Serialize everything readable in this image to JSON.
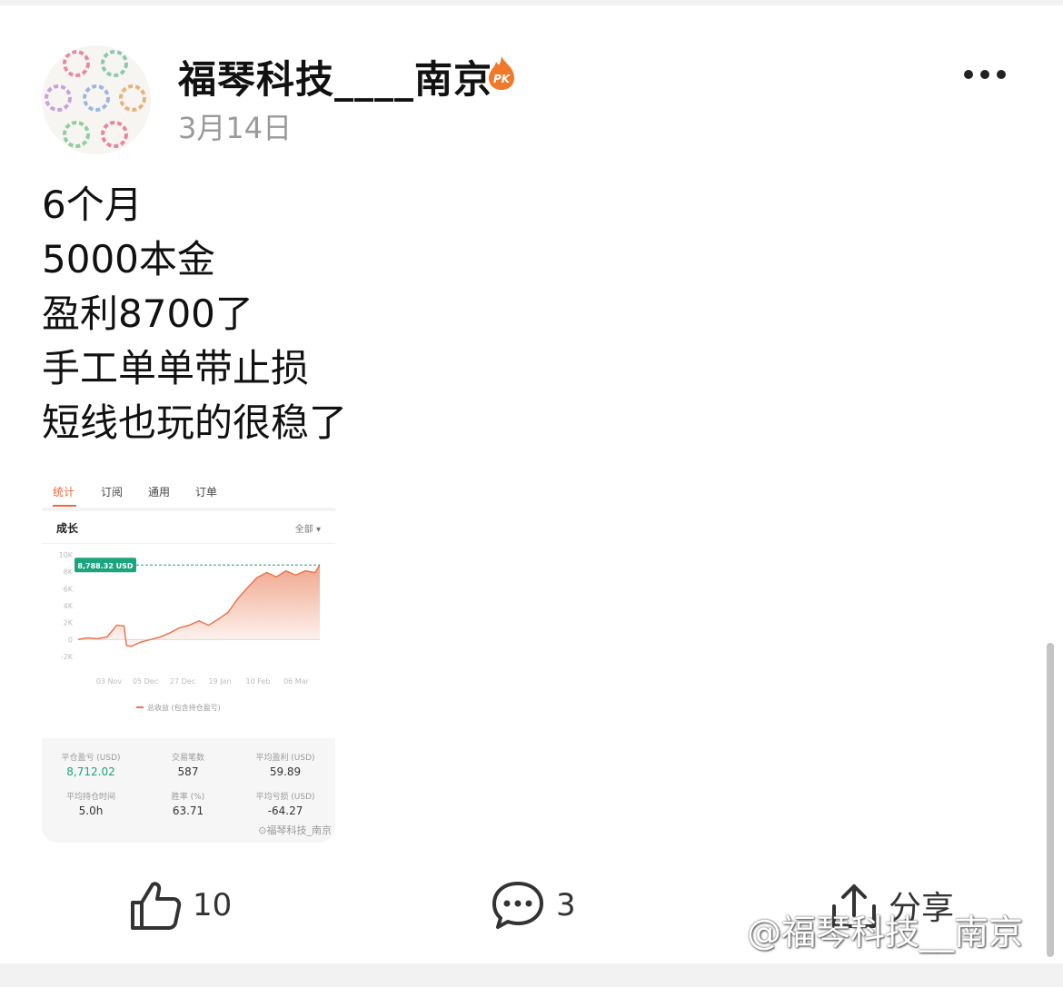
{
  "post": {
    "username": "福琴科技____南京",
    "date": "3月14日",
    "lines": [
      "6个月",
      "5000本金",
      "盈利8700了",
      "手工单单带止损",
      "短线也玩的很稳了"
    ]
  },
  "badge_icon": "pk-flame-icon",
  "image": {
    "tabs": [
      "统计",
      "订阅",
      "通用",
      "订单"
    ],
    "active_tab": "统计",
    "panel_title": "成长",
    "filter": "全部 ▾",
    "chart_data": {
      "type": "area",
      "y_ticks": [
        "10K",
        "8K",
        "6K",
        "4K",
        "2K",
        "0",
        "-2K"
      ],
      "x_ticks": [
        "03 Nov",
        "05 Dec",
        "27 Dec",
        "19 Jan",
        "10 Feb",
        "06 Mar"
      ],
      "ylim": [
        -2000,
        10000
      ],
      "series": [
        {
          "name": "总收益 (包含持仓盈亏)",
          "x": [
            0,
            4,
            8,
            12,
            16,
            19,
            20,
            22,
            26,
            30,
            34,
            38,
            42,
            46,
            50,
            54,
            58,
            62,
            66,
            70,
            74,
            78,
            82,
            86,
            90,
            94,
            98,
            100
          ],
          "values": [
            0,
            200,
            100,
            300,
            1700,
            1600,
            -700,
            -800,
            -300,
            0,
            300,
            800,
            1400,
            1700,
            2200,
            1700,
            2400,
            3200,
            4800,
            6100,
            7300,
            7900,
            7400,
            8100,
            7600,
            8100,
            7900,
            8788
          ]
        }
      ],
      "current_label": "8,788.32 USD",
      "color": "#e8764f"
    },
    "stats": [
      {
        "label": "平仓盈亏 (USD)",
        "value": "8,712.02",
        "highlight": true
      },
      {
        "label": "交易笔数",
        "value": "587",
        "highlight": false
      },
      {
        "label": "平均盈利 (USD)",
        "value": "59.89",
        "highlight": false
      },
      {
        "label": "平均持仓时间",
        "value": "5.0h",
        "highlight": false
      },
      {
        "label": "胜率 (%)",
        "value": "63.71",
        "highlight": false
      },
      {
        "label": "平均亏损 (USD)",
        "value": "-64.27",
        "highlight": false
      }
    ],
    "watermark": "⊙福琴科技_南京"
  },
  "actions": {
    "like_count": "10",
    "comment_count": "3",
    "share_label": "分享"
  },
  "page_watermark": "@福琴科技__南京"
}
